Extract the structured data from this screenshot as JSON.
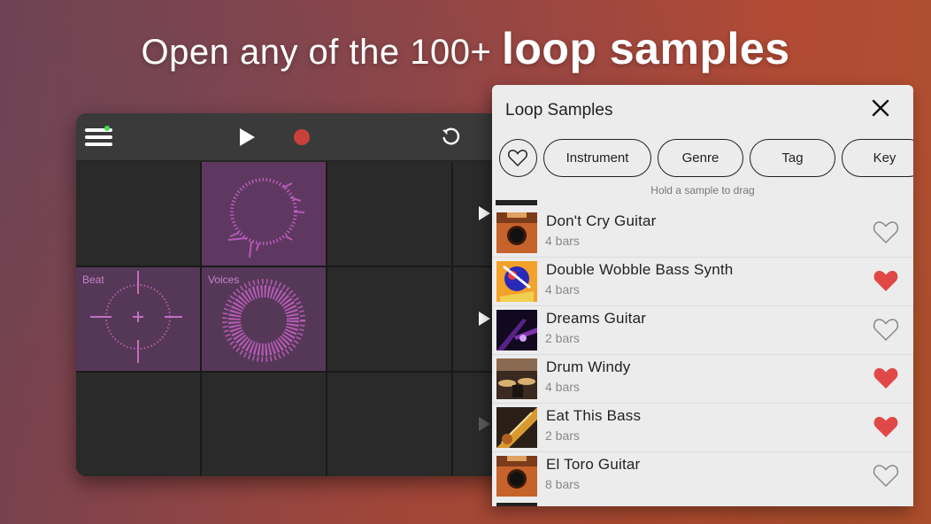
{
  "headline": {
    "light": "Open any of the 100+",
    "bold": "loop samples"
  },
  "app": {
    "icons": [
      "menu-icon",
      "play-icon",
      "record-icon",
      "undo-icon"
    ],
    "colors": {
      "record": "#c7413a",
      "status_dot": "#3fe05a",
      "pad_active": "#5e3860",
      "pad_label": "#c983c8"
    },
    "pads": [
      {
        "label": ""
      },
      {
        "label": ""
      },
      {
        "label": ""
      },
      {
        "label": ""
      },
      {
        "label": "Beat"
      },
      {
        "label": "Voices"
      },
      {
        "label": ""
      },
      {
        "label": ""
      },
      {
        "label": ""
      },
      {
        "label": ""
      },
      {
        "label": ""
      },
      {
        "label": ""
      }
    ]
  },
  "panel": {
    "title": "Loop Samples",
    "filters": [
      "Instrument",
      "Genre",
      "Tag",
      "Key"
    ],
    "hint": "Hold a sample to drag",
    "colors": {
      "favorite": "#e04848",
      "unfavorite_outline": "#888888"
    },
    "items": [
      {
        "name": "Don't Cry Guitar",
        "bars": "4 bars",
        "favorite": false,
        "thumb": "guitar"
      },
      {
        "name": "Double Wobble Bass Synth",
        "bars": "4 bars",
        "favorite": true,
        "thumb": "synth-art"
      },
      {
        "name": "Dreams Guitar",
        "bars": "2 bars",
        "favorite": false,
        "thumb": "stage-lights"
      },
      {
        "name": "Drum Windy",
        "bars": "4 bars",
        "favorite": true,
        "thumb": "drum-kit"
      },
      {
        "name": "Eat This Bass",
        "bars": "2 bars",
        "favorite": true,
        "thumb": "bass-guitar"
      },
      {
        "name": "El Toro Guitar",
        "bars": "8 bars",
        "favorite": false,
        "thumb": "guitar"
      }
    ]
  }
}
